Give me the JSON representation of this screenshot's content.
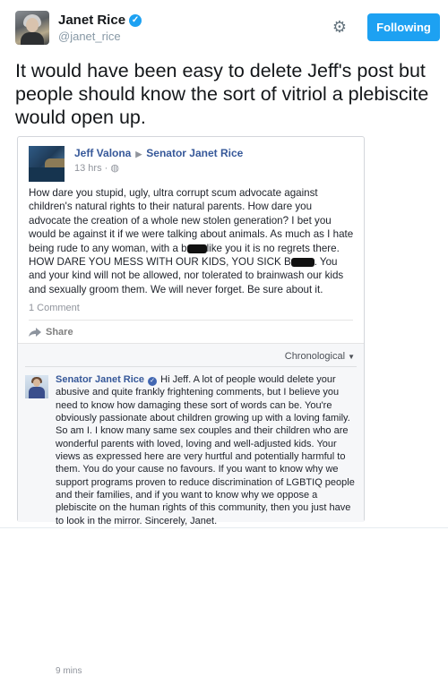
{
  "tweet": {
    "user": {
      "name": "Janet Rice",
      "handle": "@janet_rice"
    },
    "follow_button": "Following",
    "text": "It would have been easy to delete Jeff's post but people should know the sort of vitriol a plebiscite would open up."
  },
  "facebook_post": {
    "author": "Jeff Valona",
    "recipient": "Senator Janet Rice",
    "time": "13 hrs ·",
    "body": {
      "part1": "How dare you stupid, ugly, ultra corrupt scum advocate against children's natural rights to their natural parents. How dare you advocate the creation of a whole new stolen generation? I bet you would be against it if we were talking about animals. As much as I hate being rude to any woman, with a b",
      "part2": "like you it is no regrets there. HOW DARE YOU MESS WITH OUR KIDS, YOU SICK B",
      "part3": ". You and your kind will not be allowed, nor tolerated to brainwash our kids and sexually groom them. We will never forget. Be sure about it."
    },
    "comment_count": "1 Comment",
    "share_label": "Share",
    "sort_label": "Chronological",
    "comment": {
      "author": "Senator Janet Rice",
      "text": "Hi Jeff. A lot of people would delete your abusive and quite frankly frightening comments, but I believe you need to know how damaging these sort of words can be. You're obviously passionate about children growing up with a loving family. So am I. I know many same sex couples and their children who are wonderful parents with loved, loving and well-adjusted kids. Your views as expressed here are very hurtful and potentially harmful to them. You do your cause no favours. If you want to know why we support programs proven to reduce discrimination of LGBTIQ people and their families, and if you want to know why we oppose a plebiscite on the human rights of this community, then you just have to look in the mirror. Sincerely, Janet.",
      "time": "9 mins"
    }
  },
  "colors": {
    "twitter_blue": "#1da1f2",
    "facebook_link": "#365899",
    "muted": "#90949c"
  },
  "icons": [
    "verified-badge-icon",
    "gear-icon",
    "globe-icon",
    "share-arrow-icon",
    "dropdown-caret-icon"
  ]
}
